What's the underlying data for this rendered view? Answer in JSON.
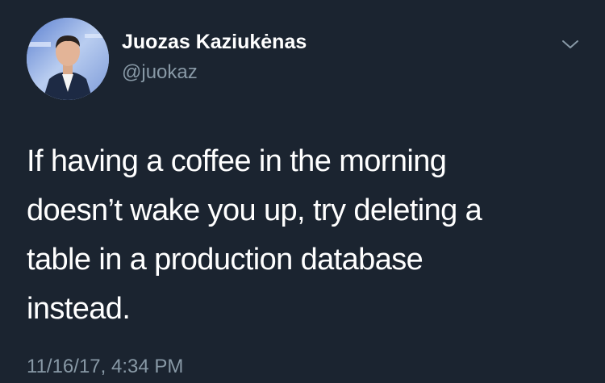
{
  "author": {
    "display_name": "Juozas Kaziukėnas",
    "handle": "@juokaz"
  },
  "tweet": {
    "text_lines": [
      "If having a coffee in the morning",
      "doesn’t wake you up, try deleting a",
      "table in a production database",
      "instead."
    ],
    "timestamp": "11/16/17, 4:34 PM"
  },
  "icons": {
    "menu": "chevron-down-icon",
    "avatar": "profile-photo"
  },
  "colors": {
    "background": "#1b2430",
    "primary_text": "#ffffff",
    "secondary_text": "#8899a6"
  }
}
